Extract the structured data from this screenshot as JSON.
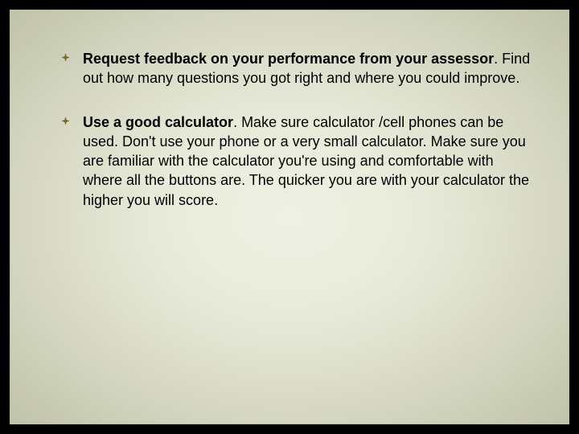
{
  "bullets": [
    {
      "bold": "Request feedback on your performance from your assessor",
      "rest": ".  Find out how many questions you got right and where you could improve."
    },
    {
      "bold": "Use a good calculator",
      "rest": ".  Make sure calculator /cell phones can be used. Don't use your phone or a very small calculator. Make sure you are familiar with the calculator you're using and comfortable with where all the buttons are. The quicker you are with your calculator the higher you will score."
    }
  ]
}
